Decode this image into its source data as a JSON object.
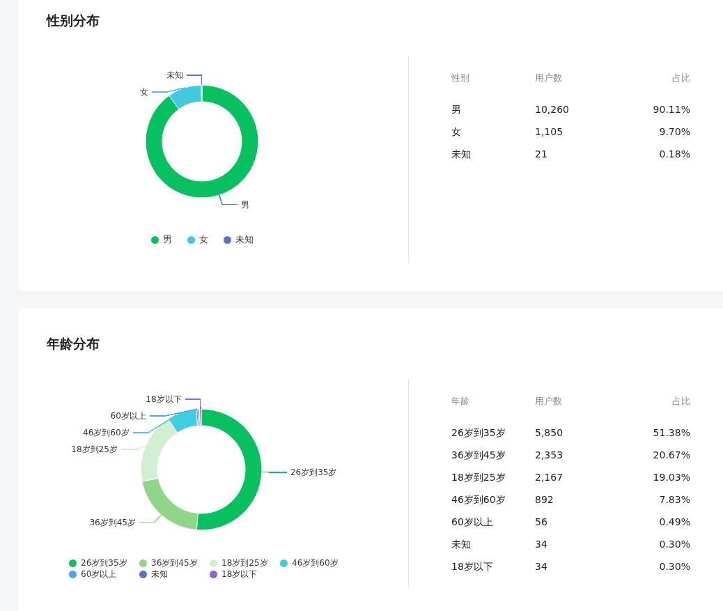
{
  "sections": [
    {
      "title": "性别分布",
      "chart_data": {
        "type": "donut",
        "categories": [
          "男",
          "女",
          "未知"
        ],
        "values": [
          90.11,
          9.7,
          0.18
        ],
        "colors": [
          "#07c160",
          "#40c9e0",
          "#5f6fcf"
        ]
      },
      "slice_labels": [
        {
          "text": "未知",
          "color": "#5f6fcf"
        },
        {
          "text": "女",
          "color": "#40c9e0"
        },
        {
          "text": "男",
          "color": "#07c160"
        }
      ],
      "table": {
        "columns": [
          "性别",
          "用户数",
          "占比"
        ],
        "rows": [
          [
            "男",
            "10,260",
            "90.11%"
          ],
          [
            "女",
            "1,105",
            "9.70%"
          ],
          [
            "未知",
            "21",
            "0.18%"
          ]
        ]
      }
    },
    {
      "title": "年龄分布",
      "chart_data": {
        "type": "donut",
        "categories": [
          "26岁到35岁",
          "36岁到45岁",
          "18岁到25岁",
          "46岁到60岁",
          "60岁以上",
          "未知",
          "18岁以下"
        ],
        "values": [
          51.38,
          20.67,
          19.03,
          7.83,
          0.49,
          0.3,
          0.3
        ],
        "colors": [
          "#07c160",
          "#8fd68a",
          "#d2efd4",
          "#40cde0",
          "#4fa3ec",
          "#5f6fcf",
          "#9260cf"
        ]
      },
      "slice_labels": [
        {
          "text": "18岁以下",
          "color": "#9260cf"
        },
        {
          "text": "60岁以上",
          "color": "#4fa3ec"
        },
        {
          "text": "46岁到60岁",
          "color": "#40cde0"
        },
        {
          "text": "18岁到25岁",
          "color": "#d2efd4"
        },
        {
          "text": "26岁到35岁",
          "color": "#07c160"
        },
        {
          "text": "36岁到45岁",
          "color": "#8fd68a"
        }
      ],
      "table": {
        "columns": [
          "年龄",
          "用户数",
          "占比"
        ],
        "rows": [
          [
            "26岁到35岁",
            "5,850",
            "51.38%"
          ],
          [
            "36岁到45岁",
            "2,353",
            "20.67%"
          ],
          [
            "18岁到25岁",
            "2,167",
            "19.03%"
          ],
          [
            "46岁到60岁",
            "892",
            "7.83%"
          ],
          [
            "60岁以上",
            "56",
            "0.49%"
          ],
          [
            "未知",
            "34",
            "0.30%"
          ],
          [
            "18岁以下",
            "34",
            "0.30%"
          ]
        ]
      }
    }
  ]
}
